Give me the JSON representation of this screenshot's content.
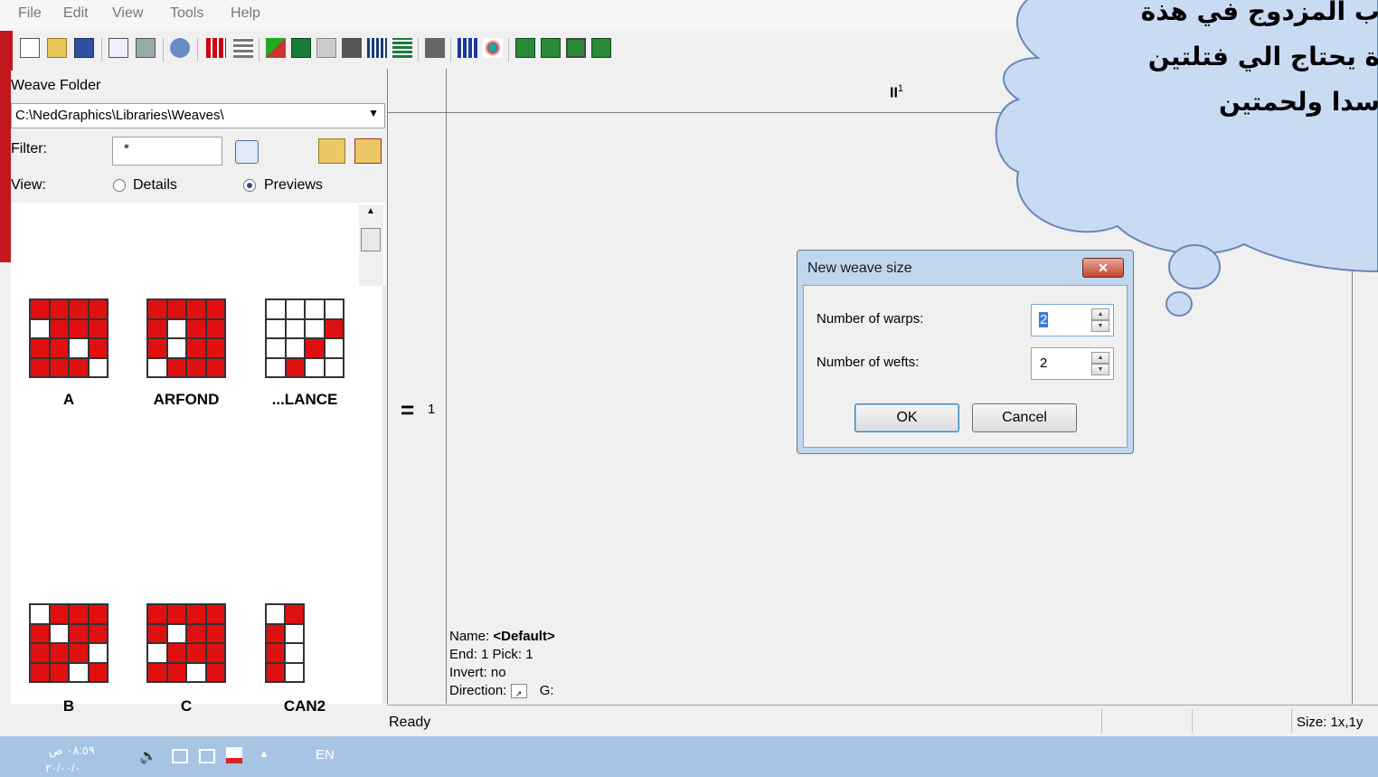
{
  "menu": [
    "File",
    "Edit",
    "View",
    "Tools",
    "Help"
  ],
  "left": {
    "folder_label": "Weave Folder",
    "folder_path": "C:\\NedGraphics\\Libraries\\Weaves\\",
    "filter_label": "Filter:",
    "filter_value": "*",
    "view_label": "View:",
    "view_details": "Details",
    "view_previews": "Previews",
    "weaves": [
      {
        "name": "A",
        "grid": "rrrr wrrr rrwr rrrw"
      },
      {
        "name": "ARFOND",
        "grid": "rrrr rwrr rwrr wrrr"
      },
      {
        "name": "...LANCE",
        "grid": "wwww wwwr wwrw wrww"
      },
      {
        "name": "B",
        "grid": "wrrr rwrr rrrw rrwr"
      },
      {
        "name": "C",
        "grid": "rrrr rwrr wrrr rrwr"
      },
      {
        "name": "CAN2",
        "grid": "wr rw rw rw"
      }
    ]
  },
  "main": {
    "col_header": "II",
    "col_header_sup": "1",
    "row_header": "=",
    "row_header_num": "1",
    "info_name_label": "Name:",
    "info_name_value": "<Default>",
    "info_end_pick": "End: 1 Pick: 1",
    "info_invert": "Invert: no",
    "info_direction": "Direction:",
    "info_g": "G:"
  },
  "status": {
    "left": "Ready",
    "right": "Size: 1x,1y"
  },
  "dialog": {
    "title": "New weave size",
    "close": "✕",
    "warps_label": "Number of warps:",
    "warps_value": "2",
    "wefts_label": "Number of wefts:",
    "wefts_value": "2",
    "ok": "OK",
    "cancel": "Cancel"
  },
  "taskbar": {
    "time": "٠٨:٥٩ ص",
    "date": "٢٠/٠٠/٠",
    "lang": "EN"
  },
  "cloud": {
    "line1": "ب المزدوج في هذة",
    "line2": "ة يحتاج الي فتلتين",
    "line3": "سدا ولحمتين"
  },
  "colors": {
    "weave_red": "#e01010",
    "cloud_fill": "#c9daf3",
    "cloud_stroke": "#6a86b8"
  }
}
